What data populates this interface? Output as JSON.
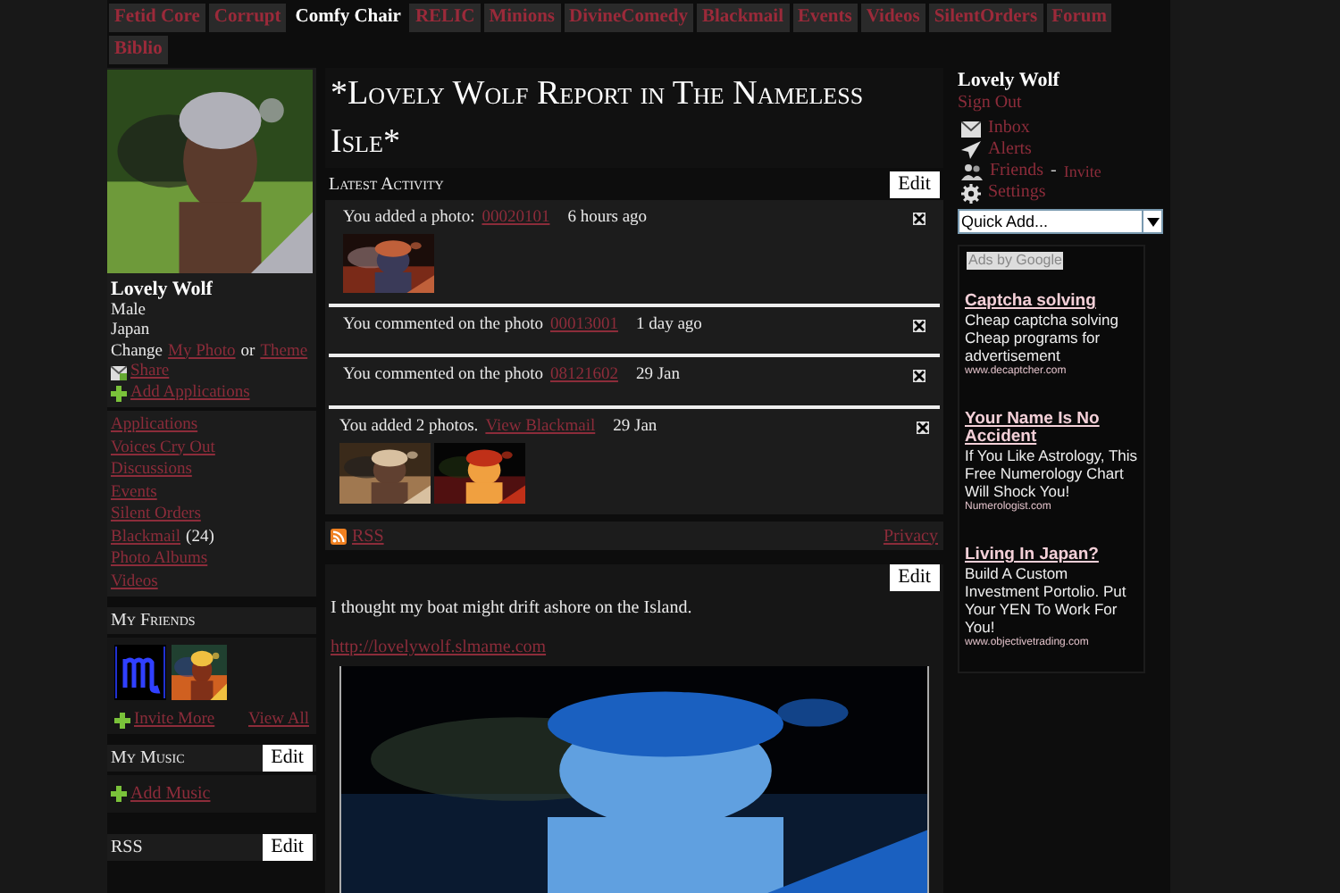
{
  "nav_tabs": [
    {
      "label": "Fetid Core",
      "selected": false
    },
    {
      "label": "Corrupt",
      "selected": false
    },
    {
      "label": "Comfy Chair",
      "selected": true
    },
    {
      "label": "RELIC",
      "selected": false
    },
    {
      "label": "Minions",
      "selected": false
    },
    {
      "label": "DivineComedy",
      "selected": false
    },
    {
      "label": "Blackmail",
      "selected": false
    },
    {
      "label": "Events",
      "selected": false
    },
    {
      "label": "Videos",
      "selected": false
    },
    {
      "label": "SilentOrders",
      "selected": false
    },
    {
      "label": "Forum",
      "selected": false
    },
    {
      "label": "Biblio",
      "selected": false
    }
  ],
  "profile": {
    "avatar": {
      "kind": "picture"
    },
    "name": "Lovely Wolf",
    "gender": "Male",
    "location": "Japan",
    "change": "Change",
    "photo_link": "My Photo",
    "or": "or",
    "theme_link": "Theme",
    "share": "Share",
    "add_applications": "Add Applications"
  },
  "applications": [
    {
      "label": "Applications"
    },
    {
      "label": "Voices Cry Out"
    },
    {
      "label": "Discussions"
    },
    {
      "label": "Events"
    },
    {
      "label": "Silent Orders"
    },
    {
      "label": "Blackmail",
      "count": "(24)"
    },
    {
      "label": "Photo Albums"
    },
    {
      "label": "Videos"
    }
  ],
  "my_friends": {
    "title": "My Friends",
    "friends": [
      {
        "kind": "sign"
      },
      {
        "kind": "picture"
      }
    ],
    "invite": "Invite More",
    "view_all": "View All"
  },
  "my_music": {
    "title": "My Music",
    "edit": "Edit",
    "add": "Add Music"
  },
  "rss_box": {
    "title": "RSS",
    "edit": "Edit"
  },
  "page_title": "*Lovely Wolf Report in The Nameless Isle*",
  "activity": {
    "title": "Latest Activity",
    "edit": "Edit",
    "items": [
      {
        "text": "You added a photo:",
        "link": "00020101",
        "time": "6 hours ago",
        "photos": [
          {
            "kind": "picture"
          }
        ]
      },
      {
        "text": "You commented on the photo",
        "link": "00013001",
        "time": "1 day ago"
      },
      {
        "text": "You commented on the photo",
        "link": "08121602",
        "time": "29 Jan"
      },
      {
        "text": "You added 2 photos.",
        "link": "View Blackmail",
        "time": "29 Jan",
        "photos": [
          {
            "kind": "picture"
          },
          {
            "kind": "picture"
          }
        ]
      }
    ],
    "rss": "RSS",
    "privacy": "Privacy"
  },
  "blog": {
    "edit": "Edit",
    "text": "I thought my boat might drift ashore on the Island.",
    "link": "http://lovelywolf.slmame.com",
    "video": {
      "kind": "picture"
    }
  },
  "user_menu": {
    "name": "Lovely Wolf",
    "sign_out": "Sign Out",
    "items": [
      {
        "label": "Inbox"
      },
      {
        "label": "Alerts"
      },
      {
        "label": "Friends",
        "separator": "-",
        "extra": "Invite"
      },
      {
        "label": "Settings"
      }
    ],
    "quick_add": "Quick Add..."
  },
  "ads": {
    "label": "Ads by Google",
    "items": [
      {
        "title": "Captcha solving",
        "body": "Cheap captcha solving Cheap programs for advertisement",
        "url": "www.decaptcher.com"
      },
      {
        "title": "Your Name Is No Accident",
        "body": "If You Like Astrology, This Free Numerology Chart Will Shock You!",
        "url": "Numerologist.com"
      },
      {
        "title": "Living In Japan?",
        "body": "Build A Custom Investment Portolio. Put Your YEN To Work For You!",
        "url": "www.objectivetrading.com"
      }
    ]
  }
}
